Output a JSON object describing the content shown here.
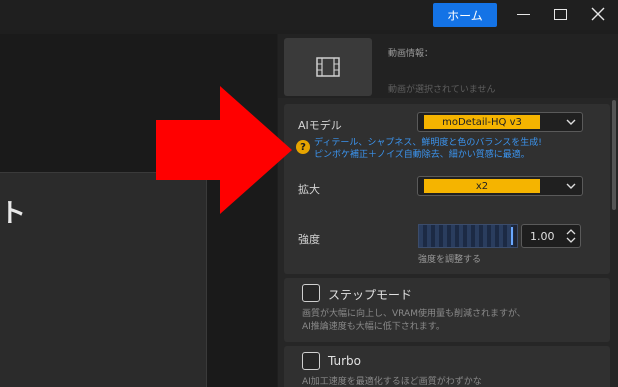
{
  "titlebar": {
    "home_label": "ホーム"
  },
  "left": {
    "partial_text": "ト"
  },
  "info": {
    "label": "動画情報：",
    "placeholder": "動画が選択されていません",
    "thumb_icon": "film-icon"
  },
  "settings": {
    "ai_model_label": "AIモデル",
    "ai_model_value": "moDetail-HQ  v3",
    "hint_line1": "ディテール、シャプネス、鮮明度と色のバランスを生成!",
    "hint_line2": "ピンボケ補正＋ノイズ自動除去、細かい質感に最適。",
    "scale_label": "拡大",
    "scale_value": "x2",
    "strength_label": "強度",
    "strength_value": "1.00",
    "strength_fill_fraction": 0.97,
    "strength_caption": "強度を調整する"
  },
  "step_mode": {
    "label": "ステップモード",
    "desc_line1": "画質が大幅に向上し、VRAM使用量も削減されますが、",
    "desc_line2": "AI推論速度も大幅に低下されます。"
  },
  "turbo": {
    "label": "Turbo",
    "desc_line1": "AI加工速度を最適化するほど画質がわずかな"
  },
  "colors": {
    "accent_blue": "#1473e6",
    "pill_yellow": "#f5b400",
    "hint_blue": "#3b95f0",
    "arrow_red": "#ff0000"
  }
}
